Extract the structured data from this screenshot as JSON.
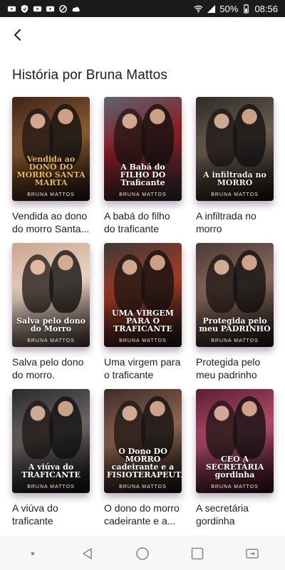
{
  "status": {
    "battery_percent": "50%",
    "time": "08:56"
  },
  "header": {
    "title": "História por Bruna Mattos"
  },
  "books": [
    {
      "title": "Vendida ao dono do morro Santa...",
      "cover_title": "Vendida ao DONO DO MORRO SANTA MARTA",
      "cover_author": "BRUNA MATTOS",
      "colors": [
        "#3b2418",
        "#8a5a2e",
        "#1e140e"
      ],
      "title_color": "#e8b94a"
    },
    {
      "title": "A babá do filho do traficante",
      "cover_title": "A Babá do FILHO DO Traficante",
      "cover_author": "BRUNA MATTOS",
      "colors": [
        "#5a6570",
        "#8c1c22",
        "#2a2e33"
      ],
      "title_color": "#ffffff"
    },
    {
      "title": "A infiltrada no morro",
      "cover_title": "A infiltrada no MORRO",
      "cover_author": "BRUNA MATTOS",
      "colors": [
        "#2e2a26",
        "#6b5e52",
        "#141210"
      ],
      "title_color": "#f0ece6"
    },
    {
      "title": "Salva pelo dono do morro.",
      "cover_title": "Salva pelo dono do Morro",
      "cover_author": "BRUNA MATTOS",
      "colors": [
        "#c9a58c",
        "#e6d2c2",
        "#4a3830"
      ],
      "title_color": "#ffffff"
    },
    {
      "title": "Uma virgem para o traficante",
      "cover_title": "UMA VIRGEM PARA O TRAFICANTE",
      "cover_author": "BRUNA MATTOS",
      "colors": [
        "#3c3a3a",
        "#a33a22",
        "#161515"
      ],
      "title_color": "#ffffff"
    },
    {
      "title": "Protegida pelo meu padrinho",
      "cover_title": "Protegida pelo meu PADRINHO",
      "cover_author": "BRUNA MATTOS",
      "colors": [
        "#4a3a36",
        "#8a6a5c",
        "#1a1514"
      ],
      "title_color": "#ffffff"
    },
    {
      "title": "A viúva do traficante",
      "cover_title": "A viúva do TRAFICANTE",
      "cover_author": "BRUNA MATTOS",
      "colors": [
        "#2a2a2c",
        "#6a6464",
        "#0e0e10"
      ],
      "title_color": "#ffffff"
    },
    {
      "title": "O dono do morro cadeirante e a...",
      "cover_title": "O Dono DO MORRO cadeirante e a FISIOTERAPEUTA",
      "cover_author": "BRUNA MATTOS",
      "colors": [
        "#3e2c26",
        "#8a6450",
        "#141010"
      ],
      "title_color": "#ffffff"
    },
    {
      "title": "A secretária gordinha",
      "cover_title": "CEO A SECRETÁRIA gordinha",
      "cover_author": "BRUNA MATTOS",
      "colors": [
        "#5a2030",
        "#b04a6a",
        "#2a1018"
      ],
      "title_color": "#ffffff"
    }
  ]
}
